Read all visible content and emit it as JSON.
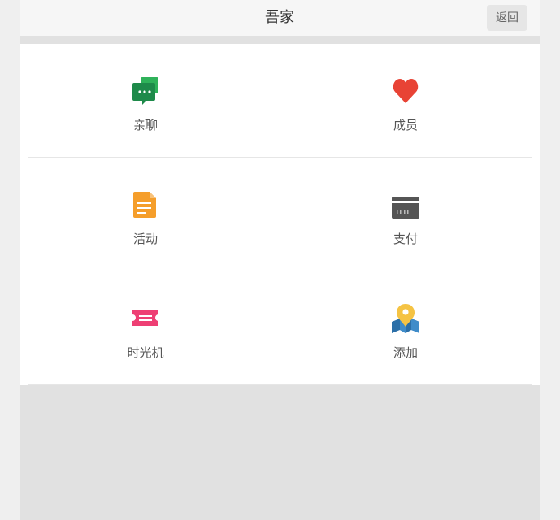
{
  "header": {
    "title": "吾家",
    "back_label": "返回"
  },
  "grid": {
    "items": [
      {
        "label": "亲聊",
        "icon": "chat-bubble-icon",
        "color": "#1e8a4a"
      },
      {
        "label": "成员",
        "icon": "heart-icon",
        "color": "#e84335"
      },
      {
        "label": "活动",
        "icon": "document-icon",
        "color": "#f59e2b"
      },
      {
        "label": "支付",
        "icon": "credit-card-icon",
        "color": "#555555"
      },
      {
        "label": "时光机",
        "icon": "ticket-icon",
        "color": "#ee3f74"
      },
      {
        "label": "添加",
        "icon": "map-pin-icon",
        "color": "#f5c343"
      }
    ]
  },
  "colors": {
    "header_bg": "#f6f6f6",
    "page_bg": "#e1e1e1",
    "grid_bg": "#ffffff"
  }
}
